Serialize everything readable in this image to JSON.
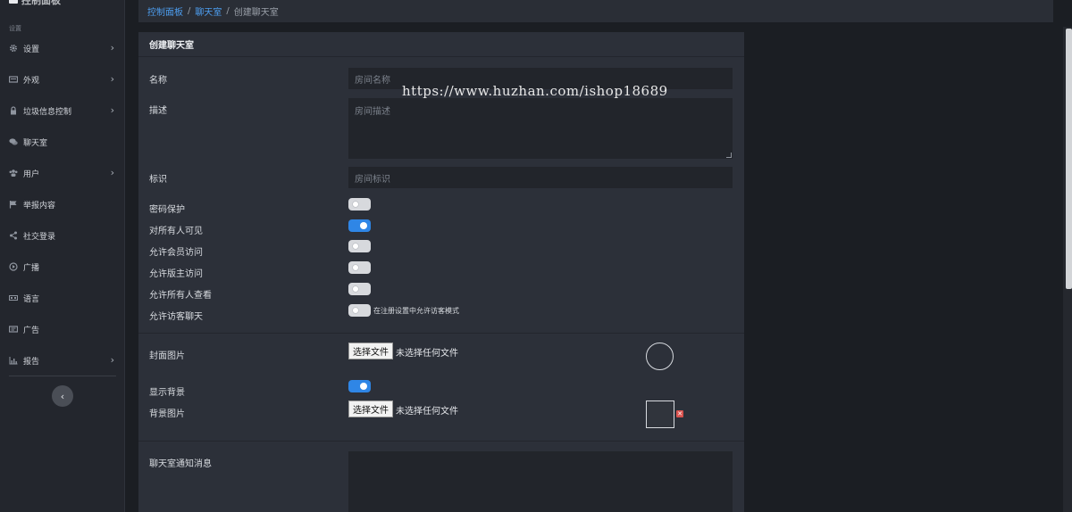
{
  "sidebar": {
    "brand": "控制面板",
    "section_label": "设置",
    "items": [
      {
        "label": "设置",
        "icon": "gear-icon",
        "has_children": true
      },
      {
        "label": "外观",
        "icon": "monitor-icon",
        "has_children": true
      },
      {
        "label": "垃圾信息控制",
        "icon": "lock-icon",
        "has_children": true
      },
      {
        "label": "聊天室",
        "icon": "chat-icon",
        "has_children": false
      },
      {
        "label": "用户",
        "icon": "users-icon",
        "has_children": true
      },
      {
        "label": "举报内容",
        "icon": "flag-icon",
        "has_children": false
      },
      {
        "label": "社交登录",
        "icon": "share-icon",
        "has_children": false
      },
      {
        "label": "广播",
        "icon": "broadcast-icon",
        "has_children": false
      },
      {
        "label": "语言",
        "icon": "language-icon",
        "has_children": false
      },
      {
        "label": "广告",
        "icon": "ad-icon",
        "has_children": false
      },
      {
        "label": "报告",
        "icon": "chart-icon",
        "has_children": true
      }
    ],
    "collapse_icon": "chevron-left-icon"
  },
  "breadcrumb": {
    "items": [
      "控制面板",
      "聊天室"
    ],
    "current": "创建聊天室",
    "separator": "/"
  },
  "form": {
    "title": "创建聊天室",
    "name_label": "名称",
    "name_placeholder": "房间名称",
    "desc_label": "描述",
    "desc_placeholder": "房间描述",
    "slug_label": "标识",
    "slug_placeholder": "房间标识",
    "toggles": [
      {
        "label": "密码保护",
        "on": false
      },
      {
        "label": "对所有人可见",
        "on": true
      },
      {
        "label": "允许会员访问",
        "on": false
      },
      {
        "label": "允许版主访问",
        "on": false
      },
      {
        "label": "允许所有人查看",
        "on": false
      },
      {
        "label": "允许访客聊天",
        "on": false
      }
    ],
    "guest_hint": "在注册设置中允许访客模式",
    "cover_label": "封面图片",
    "file_button": "选择文件",
    "file_none": "未选择任何文件",
    "show_bg_label": "显示背景",
    "show_bg_on": true,
    "bg_label": "背景图片",
    "delete_icon": "close-icon",
    "notice_label": "聊天室通知消息"
  },
  "watermark": "https://www.huzhan.com/ishop18689",
  "colors": {
    "accent": "#2f86e6",
    "link": "#4d9ef0",
    "danger": "#d9534f"
  }
}
